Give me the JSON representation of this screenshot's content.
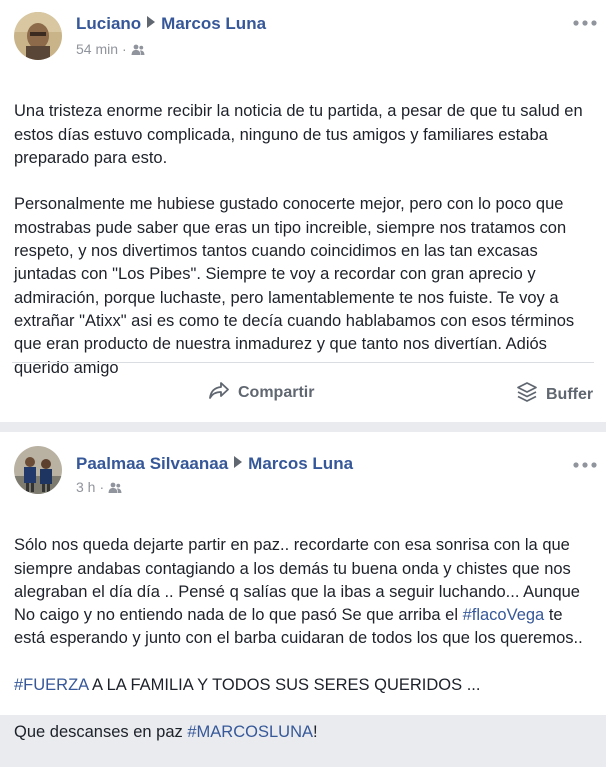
{
  "posts": [
    {
      "author": "Luciano",
      "target": "Marcos Luna",
      "time": "54 min",
      "audience_icon": "friends-icon",
      "paragraphs": [
        "Una tristeza enorme recibir la noticia de tu partida, a pesar de que tu salud en estos días estuvo complicada, ninguno de tus amigos y familiares estaba preparado para esto.",
        "Personalmente me hubiese gustado conocerte mejor, pero con lo poco que mostrabas pude saber que eras un tipo increible, siempre nos tratamos con respeto, y nos divertimos tantos cuando coincidimos en las tan excasas juntadas con \"Los Pibes\". Siempre te voy a recordar con gran aprecio y admiración, porque luchaste, pero lamentablemente te nos fuiste. Te voy a extrañar \"Atixx\" asi es como te decía cuando hablabamos con esos términos que eran producto de nuestra inmadurez y que tanto nos divertían. Adiós querido amigo"
      ],
      "actions": {
        "share": "Compartir",
        "buffer": "Buffer"
      }
    },
    {
      "author": "Paalmaa Silvaanaa",
      "target": "Marcos Luna",
      "time": "3 h",
      "audience_icon": "friends-icon",
      "text_a": "Sólo nos queda dejarte partir en paz.. recordarte con esa sonrisa con la que siempre andabas contagiando a los demás tu buena onda y chistes que nos alegraban el día día .. Pensé q salías que la ibas a seguir luchando... Aunque No caigo y no entiendo nada de lo que pasó Se que arriba el ",
      "hashtag_1": "#flacoVega",
      "text_b": " te está esperando y junto con el barba cuidaran de todos los que los queremos..",
      "hashtag_2": "#FUERZA",
      "text_c": " A LA FAMILIA Y TODOS SUS SERES QUERIDOS ...",
      "text_d": "Que descanses en paz ",
      "hashtag_3": "#MARCOSLUNA",
      "text_e": "!"
    }
  ],
  "colors": {
    "link": "#365899",
    "text": "#1d2129",
    "meta": "#90949c",
    "action": "#606770"
  }
}
